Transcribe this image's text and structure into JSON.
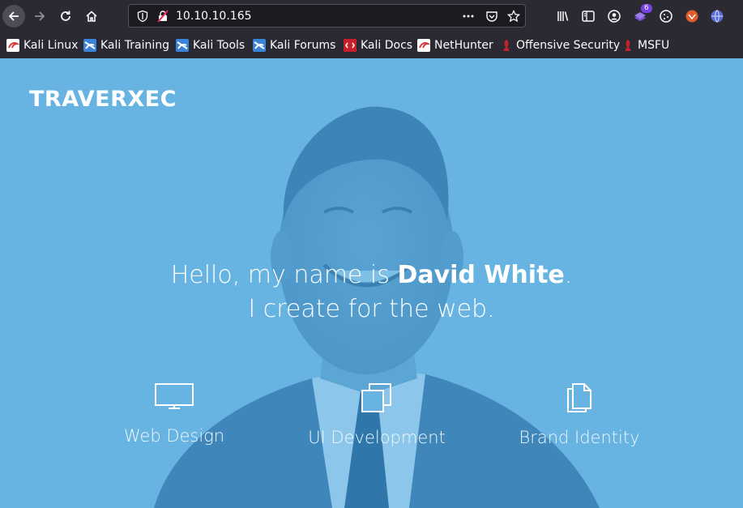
{
  "browser": {
    "url": "10.10.10.165",
    "extension_badge": "6",
    "bookmarks": [
      {
        "label": "Kali Linux",
        "icon": "kali-dragon-icon"
      },
      {
        "label": "Kali Training",
        "icon": "kali-training-icon"
      },
      {
        "label": "Kali Tools",
        "icon": "kali-tools-icon"
      },
      {
        "label": "Kali Forums",
        "icon": "kali-forums-icon"
      },
      {
        "label": "Kali Docs",
        "icon": "kali-docs-icon"
      },
      {
        "label": "NetHunter",
        "icon": "nethunter-icon"
      },
      {
        "label": "Offensive Security",
        "icon": "offsec-icon"
      },
      {
        "label": "MSFU",
        "icon": "msfu-icon"
      }
    ]
  },
  "site": {
    "logo": "TRAVERXEC",
    "hero": {
      "greeting": "Hello, my name is ",
      "name": "David White",
      "period": ".",
      "tagline": "I create for the web."
    },
    "services": [
      {
        "label": "Web Design",
        "icon": "monitor-icon"
      },
      {
        "label": "UI Development",
        "icon": "layers-icon"
      },
      {
        "label": "Brand Identity",
        "icon": "documents-icon"
      }
    ],
    "colors": {
      "overlay": "#67b3e2",
      "toolbar": "#2b2a33",
      "text": "#ffffff"
    }
  }
}
